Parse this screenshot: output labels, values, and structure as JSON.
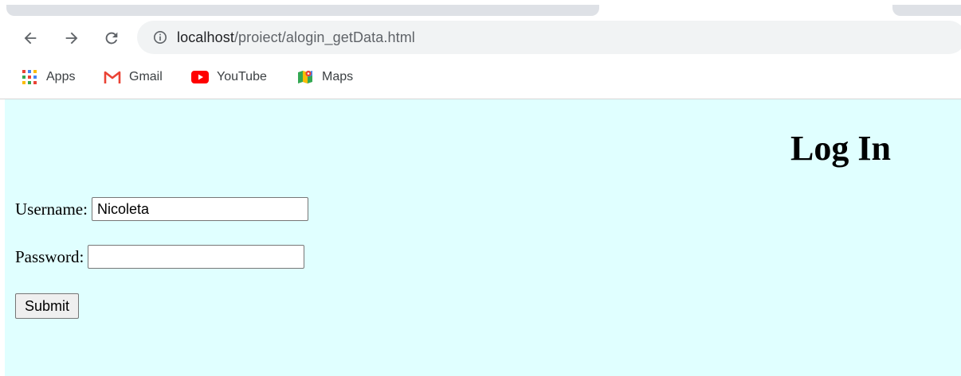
{
  "browser": {
    "url_host": "localhost",
    "url_path": "/proiect/alogin_getData.html",
    "bookmarks": [
      {
        "label": "Apps",
        "icon": "apps-grid-icon"
      },
      {
        "label": "Gmail",
        "icon": "gmail-icon"
      },
      {
        "label": "YouTube",
        "icon": "youtube-icon"
      },
      {
        "label": "Maps",
        "icon": "maps-icon"
      }
    ]
  },
  "page": {
    "title": "Log In",
    "username_label": "Username:",
    "username_value": "Nicoleta",
    "password_label": "Password:",
    "password_value": "",
    "submit_label": "Submit",
    "background_color": "#e0ffff"
  }
}
